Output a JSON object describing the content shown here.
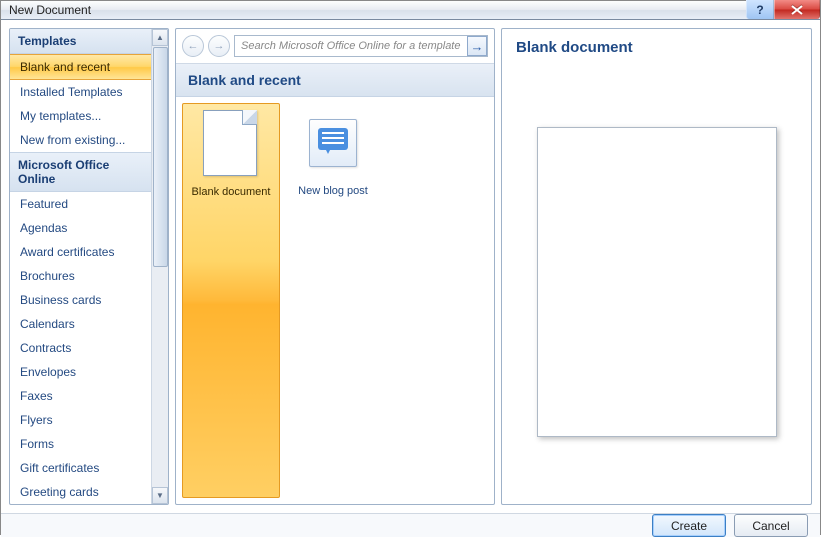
{
  "window": {
    "title": "New Document"
  },
  "sidebar": {
    "header1": "Templates",
    "header2": "Microsoft Office Online",
    "group1": [
      "Blank and recent",
      "Installed Templates",
      "My templates...",
      "New from existing..."
    ],
    "group2": [
      "Featured",
      "Agendas",
      "Award certificates",
      "Brochures",
      "Business cards",
      "Calendars",
      "Contracts",
      "Envelopes",
      "Faxes",
      "Flyers",
      "Forms",
      "Gift certificates",
      "Greeting cards"
    ],
    "selected": "Blank and recent"
  },
  "mid": {
    "search_placeholder": "Search Microsoft Office Online for a template",
    "section_title": "Blank and recent",
    "templates": [
      {
        "name": "Blank document",
        "icon": "page-icon"
      },
      {
        "name": "New blog post",
        "icon": "blog-icon"
      }
    ],
    "selected": "Blank document"
  },
  "right": {
    "title": "Blank document"
  },
  "footer": {
    "create": "Create",
    "cancel": "Cancel"
  },
  "colors": {
    "accent_blue": "#204a85",
    "selection_orange_top": "#ffe8a4",
    "selection_orange_bottom": "#ffb42f"
  }
}
